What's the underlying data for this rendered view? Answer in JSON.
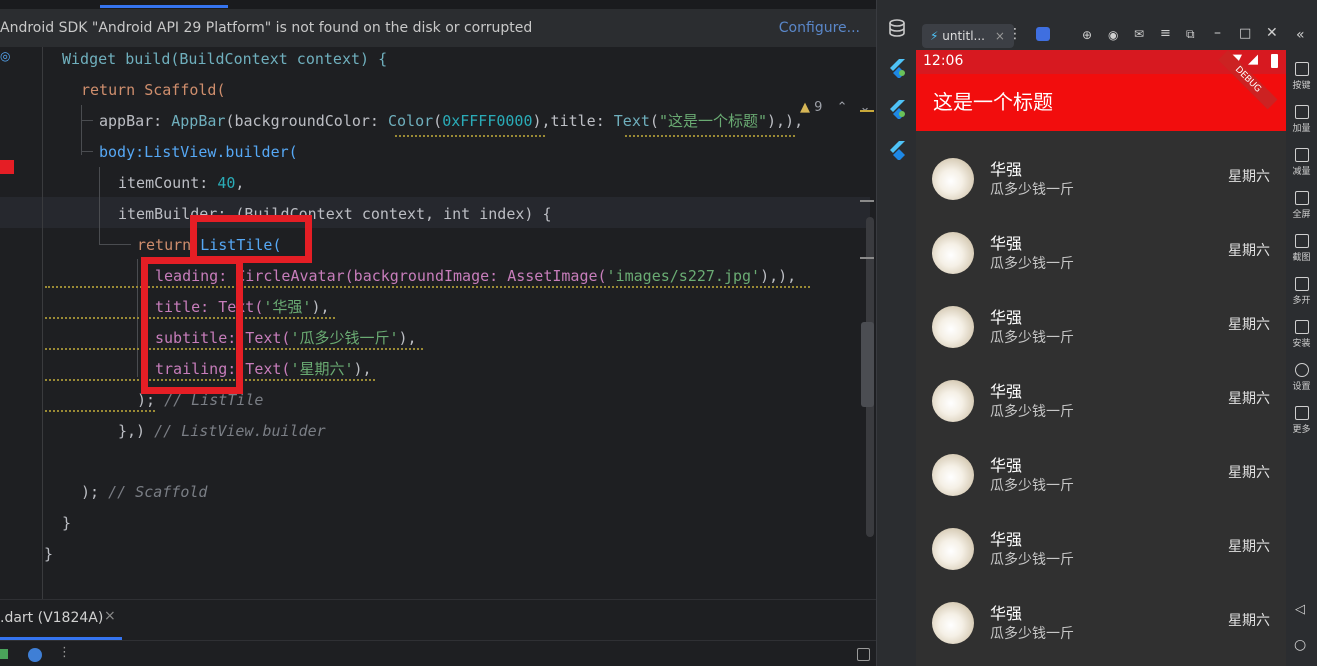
{
  "ide": {
    "banner_text": "Android SDK \"Android API 29 Platform\" is not found on the disk or corrupted",
    "banner_link": "Configure...",
    "warnings_count": "9",
    "code_lines": {
      "l1_a": "Widget build(BuildContext context) {",
      "l2": "return Scaffold(",
      "l3_prop": "appBar: ",
      "l3_type": "AppBar",
      "l3_b": "(backgroundColor: ",
      "l3_color": "Color",
      "l3_c": "(",
      "l3_num": "0xFFFF0000",
      "l3_d": "),title: ",
      "l3_text": "Text",
      "l3_e": "(",
      "l3_str": "\"这是一个标题\"",
      "l3_f": "),),",
      "l4": "body:ListView.builder(",
      "l5_prop": "itemCount: ",
      "l5_num": "40",
      "l5_end": ",",
      "l6_a": "itemBuilder: (BuildContext context, int index) {",
      "l7_kw": "return ",
      "l7_b": "ListTile(",
      "l8_a": "leading: CircleAvatar(backgroundImage: AssetImage(",
      "l8_str": "'images/s227.jpg'",
      "l8_b": "),),",
      "l9_a": "title: Text(",
      "l9_str": "'华强'",
      "l9_b": "),",
      "l10_a": "subtitle: Text(",
      "l10_str": "'瓜多少钱一斤'",
      "l10_b": "),",
      "l11_a": "trailing: Text(",
      "l11_str": "'星期六'",
      "l11_b": "),",
      "l12_a": "); ",
      "l12_cm": "// ListTile",
      "l13_a": "},) ",
      "l13_cm": "// ListView.builder",
      "l15_a": "); ",
      "l15_cm": "// Scaffold",
      "l16": "}",
      "l17": "}"
    },
    "bottom_tab_label": ".dart (V1824A)",
    "bottom_tab_close": "×"
  },
  "emulator": {
    "tab_label": "untitl...",
    "tab_close": "×",
    "clock": "12:06",
    "debug_banner": "DEBUG",
    "app_title": "这是一个标题",
    "list": [
      {
        "title": "华强",
        "subtitle": "瓜多少钱一斤",
        "trailing": "星期六"
      },
      {
        "title": "华强",
        "subtitle": "瓜多少钱一斤",
        "trailing": "星期六"
      },
      {
        "title": "华强",
        "subtitle": "瓜多少钱一斤",
        "trailing": "星期六"
      },
      {
        "title": "华强",
        "subtitle": "瓜多少钱一斤",
        "trailing": "星期六"
      },
      {
        "title": "华强",
        "subtitle": "瓜多少钱一斤",
        "trailing": "星期六"
      },
      {
        "title": "华强",
        "subtitle": "瓜多少钱一斤",
        "trailing": "星期六"
      },
      {
        "title": "华强",
        "subtitle": "瓜多少钱一斤",
        "trailing": "星期六"
      }
    ],
    "side_panel": [
      "按键",
      "加量",
      "减量",
      "全屏",
      "截图",
      "多开",
      "安装",
      "设置",
      "更多"
    ]
  },
  "colors": {
    "app_bar": "#f20d0d",
    "highlight_box": "#e51e25",
    "ide_background": "#1e1f22"
  }
}
